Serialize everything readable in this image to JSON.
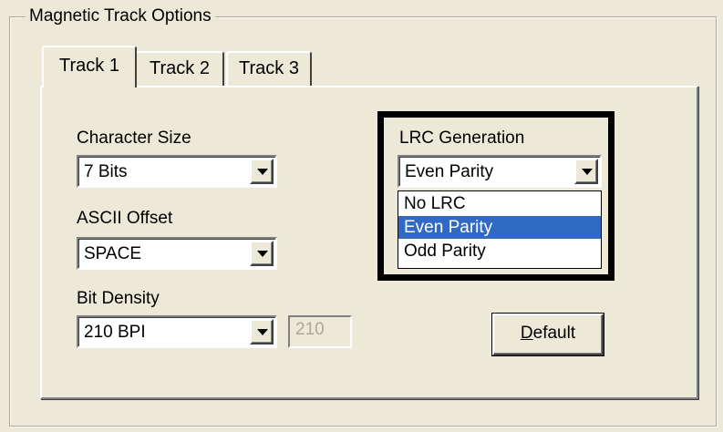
{
  "group": {
    "title": "Magnetic Track Options"
  },
  "tabs": [
    {
      "label": "Track 1",
      "active": true
    },
    {
      "label": "Track 2",
      "active": false
    },
    {
      "label": "Track 3",
      "active": false
    }
  ],
  "character_size": {
    "label": "Character Size",
    "value": "7 Bits"
  },
  "ascii_offset": {
    "label": "ASCII Offset",
    "value": "SPACE"
  },
  "bit_density": {
    "label": "Bit Density",
    "value": "210 BPI",
    "custom_value": "210"
  },
  "lrc_generation": {
    "label": "LRC Generation",
    "value": "Even Parity",
    "options": [
      "No LRC",
      "Even Parity",
      "Odd Parity"
    ],
    "highlighted_option": "Even Parity"
  },
  "default_button": {
    "label_prefix": "",
    "label_underlined": "D",
    "label_rest": "efault"
  },
  "colors": {
    "window_bg": "#ece9d8",
    "selection": "#316ac5"
  }
}
